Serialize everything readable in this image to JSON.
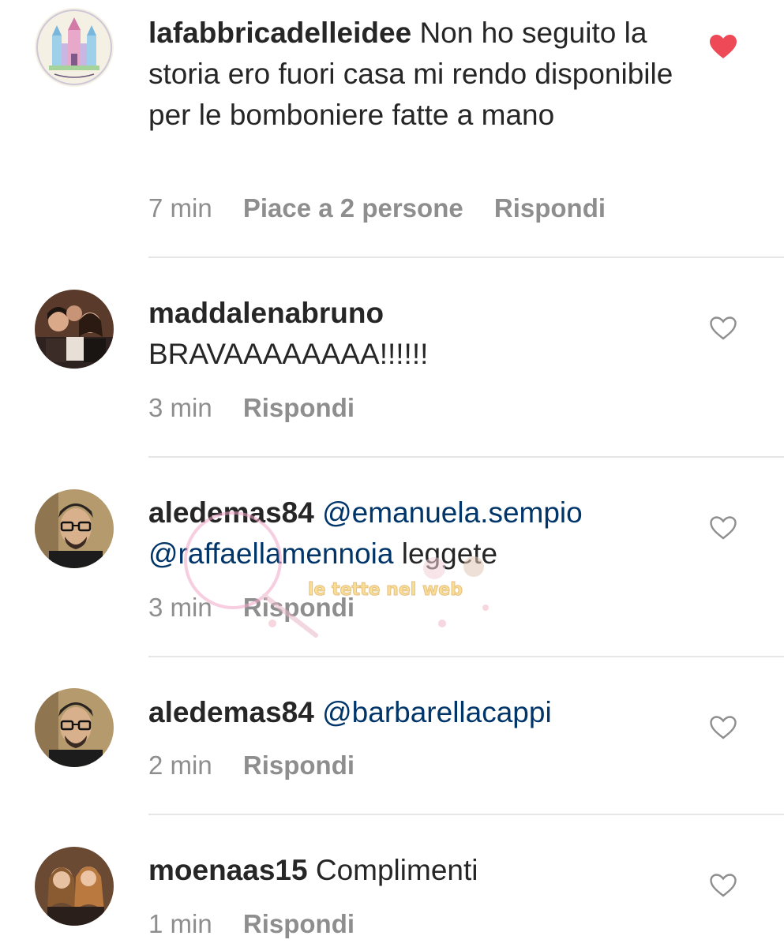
{
  "comments": [
    {
      "username": "lafabbricadelleidee",
      "text": "Non ho seguito la storia ero fuori casa mi rendo disponibile per le bomboniere fatte a mano",
      "time": "7 min",
      "likes": "Piace a 2 persone",
      "reply": "Rispondi",
      "liked": true,
      "avatar_icon": "castle-logo-avatar"
    },
    {
      "username": "maddalenabruno",
      "text": "BRAVAAAAAAAA!!!!!!",
      "time": "3 min",
      "reply": "Rispondi",
      "liked": false,
      "avatar_icon": "group-photo-avatar"
    },
    {
      "username": "aledemas84",
      "mentions": [
        "@emanuela.sempio",
        "@raffaellamennoia"
      ],
      "text": "leggete",
      "time": "3 min",
      "reply": "Rispondi",
      "liked": false,
      "avatar_icon": "man-with-glasses-avatar"
    },
    {
      "username": "aledemas84",
      "mentions": [
        "@barbarellacappi"
      ],
      "time": "2 min",
      "reply": "Rispondi",
      "liked": false,
      "avatar_icon": "man-with-glasses-avatar"
    },
    {
      "username": "moenaas15",
      "text": "Complimenti",
      "time": "1 min",
      "reply": "Rispondi",
      "liked": false,
      "avatar_icon": "two-women-avatar"
    }
  ],
  "colors": {
    "text": "#262626",
    "muted": "#8e8e8e",
    "mention": "#003569",
    "heart_liked": "#ed4956",
    "divider": "#e6e6e6"
  },
  "watermark": {
    "text": "le tette nel web"
  }
}
